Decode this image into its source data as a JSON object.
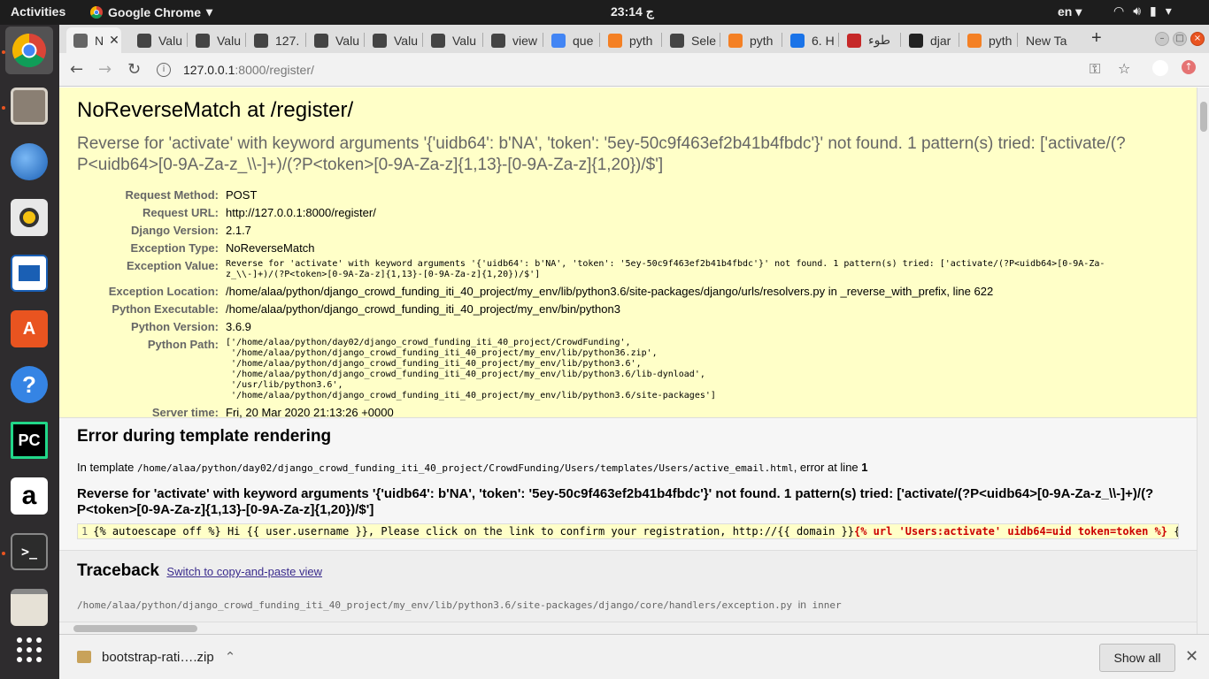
{
  "topbar": {
    "activities": "Activities",
    "app_name": "Google Chrome",
    "clock": "23:14 ج",
    "lang": "en"
  },
  "dock": {
    "items": [
      "Chromium",
      "Files",
      "Thunderbird",
      "Rhythmbox",
      "LibreOffice Writer",
      "Ubuntu Software",
      "Help",
      "PyCharm",
      "Amazon",
      "Terminal",
      "Text Editor",
      "Show Applications"
    ],
    "labels": {
      "pycharm": "PC",
      "amazon": "a",
      "help": "?",
      "software": "A",
      "terminal": ">_"
    }
  },
  "tabs": [
    {
      "label": "N",
      "active": true
    },
    {
      "label": "Valu"
    },
    {
      "label": "Valu"
    },
    {
      "label": "127."
    },
    {
      "label": "Valu"
    },
    {
      "label": "Valu"
    },
    {
      "label": "Valu"
    },
    {
      "label": "view"
    },
    {
      "label": "que"
    },
    {
      "label": "pyth"
    },
    {
      "label": "Sele"
    },
    {
      "label": "pyth"
    },
    {
      "label": "6. H"
    },
    {
      "label": "طوء"
    },
    {
      "label": "djar"
    },
    {
      "label": "pyth"
    },
    {
      "label": "New Ta"
    }
  ],
  "toolbar": {
    "url_host": "127.0.0.1",
    "url_rest": ":8000/register/"
  },
  "error": {
    "title": "NoReverseMatch at /register/",
    "summary": "Reverse for 'activate' with keyword arguments '{'uidb64': b'NA', 'token': '5ey-50c9f463ef2b41b4fbdc'}' not found. 1 pattern(s) tried: ['activate/(?P<uidb64>[0-9A-Za-z_\\\\-]+)/(?P<token>[0-9A-Za-z]{1,13}-[0-9A-Za-z]{1,20})/$']",
    "meta": [
      {
        "label": "Request Method:",
        "value": "POST"
      },
      {
        "label": "Request URL:",
        "value": "http://127.0.0.1:8000/register/"
      },
      {
        "label": "Django Version:",
        "value": "2.1.7"
      },
      {
        "label": "Exception Type:",
        "value": "NoReverseMatch"
      },
      {
        "label": "Exception Value:",
        "value": "Reverse for 'activate' with keyword arguments '{'uidb64': b'NA', 'token': '5ey-50c9f463ef2b41b4fbdc'}' not found. 1 pattern(s) tried: ['activate/(?P<uidb64>[0-9A-Za-z_\\\\-]+)/(?P<token>[0-9A-Za-z]{1,13}-[0-9A-Za-z]{1,20})/$']",
        "mono": true
      },
      {
        "label": "Exception Location:",
        "value": "/home/alaa/python/django_crowd_funding_iti_40_project/my_env/lib/python3.6/site-packages/django/urls/resolvers.py in _reverse_with_prefix, line 622"
      },
      {
        "label": "Python Executable:",
        "value": "/home/alaa/python/django_crowd_funding_iti_40_project/my_env/bin/python3"
      },
      {
        "label": "Python Version:",
        "value": "3.6.9"
      },
      {
        "label": "Python Path:",
        "value": "['/home/alaa/python/day02/django_crowd_funding_iti_40_project/CrowdFunding',\n '/home/alaa/python/django_crowd_funding_iti_40_project/my_env/lib/python36.zip',\n '/home/alaa/python/django_crowd_funding_iti_40_project/my_env/lib/python3.6',\n '/home/alaa/python/django_crowd_funding_iti_40_project/my_env/lib/python3.6/lib-dynload',\n '/usr/lib/python3.6',\n '/home/alaa/python/django_crowd_funding_iti_40_project/my_env/lib/python3.6/site-packages']",
        "mono": true
      },
      {
        "label": "Server time:",
        "value": "Fri, 20 Mar 2020 21:13:26 +0000"
      }
    ]
  },
  "template_error": {
    "heading": "Error during template rendering",
    "in_template_prefix": "In template",
    "template_path": "/home/alaa/python/day02/django_crowd_funding_iti_40_project/CrowdFunding/Users/templates/Users/active_email.html",
    "error_at_line_text": ", error at line",
    "line_number": "1",
    "message": "Reverse for 'activate' with keyword arguments '{'uidb64': b'NA', 'token': '5ey-50c9f463ef2b41b4fbdc'}' not found. 1 pattern(s) tried: ['activate/(?P<uidb64>[0-9A-Za-z_\\\\-]+)/(?P<token>[0-9A-Za-z]{1,13}-[0-9A-Za-z]{1,20})/$']",
    "source_line_no": "1",
    "source_before": "{% autoescape off %} Hi {{ user.username }}, Please click on the link to confirm your registration, http://{{ domain }}",
    "source_error": "{% url 'Users:activate' uidb64=uid token=token %}",
    "source_after": " {%"
  },
  "traceback": {
    "heading": "Traceback",
    "switch_link": "Switch to copy-and-paste view",
    "frame_path": "/home/alaa/python/django_crowd_funding_iti_40_project/my_env/lib/python3.6/site-packages/django/core/handlers/exception.py",
    "frame_in": "in",
    "frame_func": "inner"
  },
  "downloads": {
    "filename": "bootstrap-rati….zip",
    "show_all": "Show all"
  }
}
